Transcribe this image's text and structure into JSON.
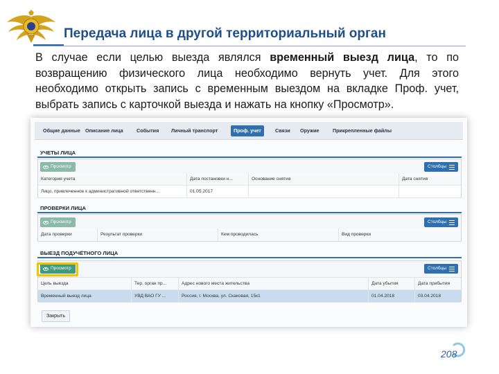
{
  "slide": {
    "title": "Передача лица в другой территориальный орган",
    "intro_part1": "В случае если целью выезда являлся ",
    "intro_bold": "временный выезд лица",
    "intro_part2": ", то по возвращению физического лица необходимо вернуть учет. Для этого необходимо открыть запись с временным выездом на вкладке Проф. учет, выбрать запись с карточкой выезда и нажать на кнопку «Просмотр».",
    "page_number": "208"
  },
  "colors": {
    "title": "#1f4e8c",
    "accent": "#2f6fb0",
    "view_button": "#3f9a7e",
    "highlight": "#f2c400",
    "selected_row": "#c9dcee"
  },
  "tabs": [
    {
      "label": "Общие данные",
      "active": false
    },
    {
      "label": "Описание лица",
      "active": false
    },
    {
      "label": "События",
      "active": false
    },
    {
      "label": "Личный транспорт",
      "active": false
    },
    {
      "label": "Проф. учет",
      "active": true
    },
    {
      "label": "Связи",
      "active": false
    },
    {
      "label": "Оружие",
      "active": false
    },
    {
      "label": "Прикрепленные файлы",
      "active": false
    }
  ],
  "buttons": {
    "view": "Просмотр",
    "columns": "Столбцы",
    "close": "Закрыть"
  },
  "sections": {
    "accounts": {
      "title": "УЧЕТЫ ЛИЦА",
      "columns": [
        "Категория учета",
        "Дата постановки н...",
        "Основание снятия",
        "Дата снятия"
      ],
      "rows": [
        [
          "Лицо, привлеченное к административной ответственн...",
          "01.05.2017",
          "",
          ""
        ]
      ]
    },
    "checks": {
      "title": "ПРОВЕРКИ ЛИЦА",
      "columns": [
        "Дата проверки",
        "Результат проверки",
        "Кем проводилась",
        "Вид проверки"
      ],
      "rows": []
    },
    "departure": {
      "title": "ВЫЕЗД ПОДУЧЁТНОГО ЛИЦА",
      "columns": [
        "Цель выезда",
        "Тер. орган пр...",
        "Адрес нового места жительства",
        "Дата убытия",
        "Дата прибытия"
      ],
      "rows": [
        [
          "Временный выезд лица",
          "УВД ВАО ГУ ...",
          "Россия, г. Москва, ул. Скаковая, 15к1",
          "01.04.2018",
          "03.04.2018"
        ]
      ]
    }
  }
}
